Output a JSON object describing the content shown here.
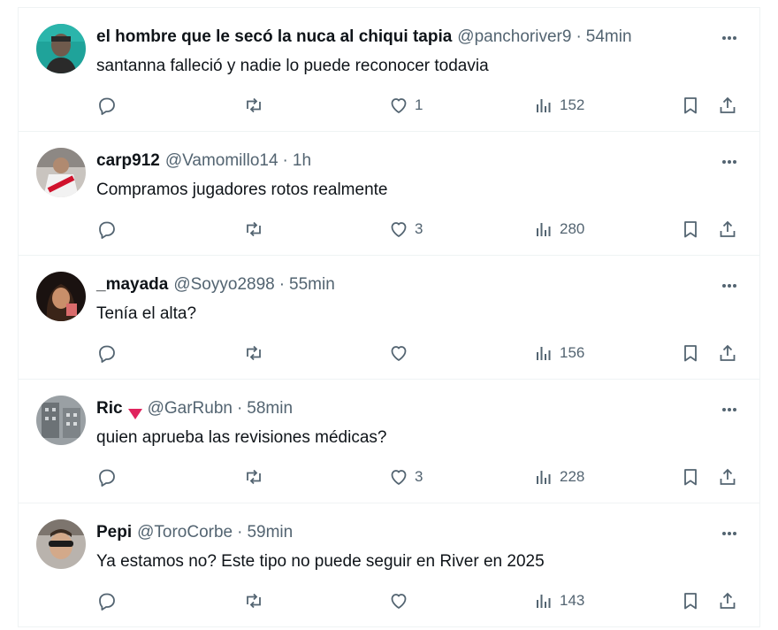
{
  "posts": [
    {
      "display_name": "el hombre que le secó la nuca al chiqui tapia",
      "handle": "@panchoriver9",
      "separator": "·",
      "time": "54min",
      "text": "santanna falleció y nadie lo puede reconocer todavia",
      "likes": "1",
      "views": "152",
      "flag": false,
      "avatar": "avatar-man-teal-background"
    },
    {
      "display_name": "carp912",
      "handle": "@Vamomillo14",
      "separator": "·",
      "time": "1h",
      "text": "Compramos jugadores rotos realmente",
      "likes": "3",
      "views": "280",
      "flag": false,
      "avatar": "avatar-river-jersey"
    },
    {
      "display_name": "_mayada",
      "handle": "@Soyyo2898",
      "separator": "·",
      "time": "55min",
      "text": "Tenía el alta?",
      "likes": "",
      "views": "156",
      "flag": false,
      "avatar": "avatar-woman-dark"
    },
    {
      "display_name": "Ric",
      "handle": "@GarRubn",
      "separator": "·",
      "time": "58min",
      "text": "quien aprueba las revisiones médicas?",
      "likes": "3",
      "views": "228",
      "flag": true,
      "flag_color": "#e0245e",
      "avatar": "avatar-building-grey"
    },
    {
      "display_name": "Pepi",
      "handle": "@ToroCorbe",
      "separator": "·",
      "time": "59min",
      "text": "Ya estamos no? Este tipo no puede seguir en River en 2025",
      "likes": "",
      "views": "143",
      "flag": false,
      "avatar": "avatar-man-sunglasses"
    }
  ],
  "icons": {
    "reply": "reply-icon",
    "repost": "repost-icon",
    "like": "heart-icon",
    "views": "views-icon",
    "bookmark": "bookmark-icon",
    "share": "share-icon",
    "more": "more-icon"
  },
  "colors": {
    "text": "#0f1419",
    "secondary": "#536471",
    "divider": "#eff3f4",
    "flag": "#e0245e"
  }
}
